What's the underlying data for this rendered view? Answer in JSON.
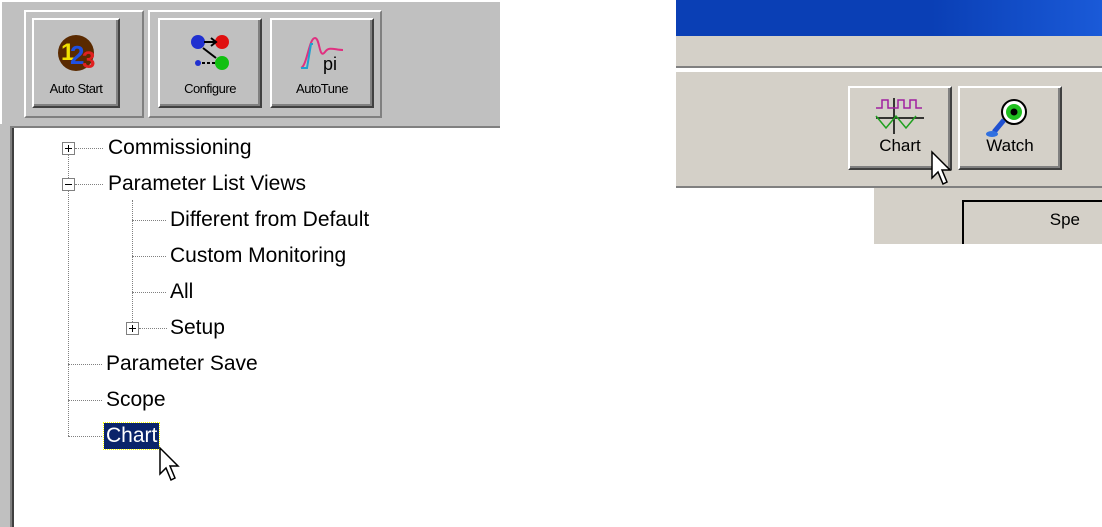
{
  "left_toolbar": {
    "buttons": [
      {
        "label": "Auto Start",
        "icon": "autostart-123-icon"
      },
      {
        "label": "Configure",
        "icon": "configure-icon"
      },
      {
        "label": "AutoTune",
        "icon": "autotune-pi-icon"
      }
    ]
  },
  "tree": {
    "items": [
      {
        "label": "Commissioning",
        "expander": "+"
      },
      {
        "label": "Parameter List Views",
        "expander": "−"
      },
      {
        "label": "Different from Default"
      },
      {
        "label": "Custom Monitoring"
      },
      {
        "label": "All"
      },
      {
        "label": "Setup",
        "expander": "+"
      },
      {
        "label": "Parameter Save"
      },
      {
        "label": "Scope"
      },
      {
        "label": "Chart",
        "selected": true
      }
    ]
  },
  "right_toolbar": {
    "buttons": [
      {
        "label": "Chart",
        "icon": "chart-icon"
      },
      {
        "label": "Watch",
        "icon": "watch-eye-icon"
      }
    ],
    "partial_label": "Spe"
  },
  "colors": {
    "selection": "#0a246a",
    "titlebar": "#0a3fb5",
    "face": "#c0c0c0"
  }
}
